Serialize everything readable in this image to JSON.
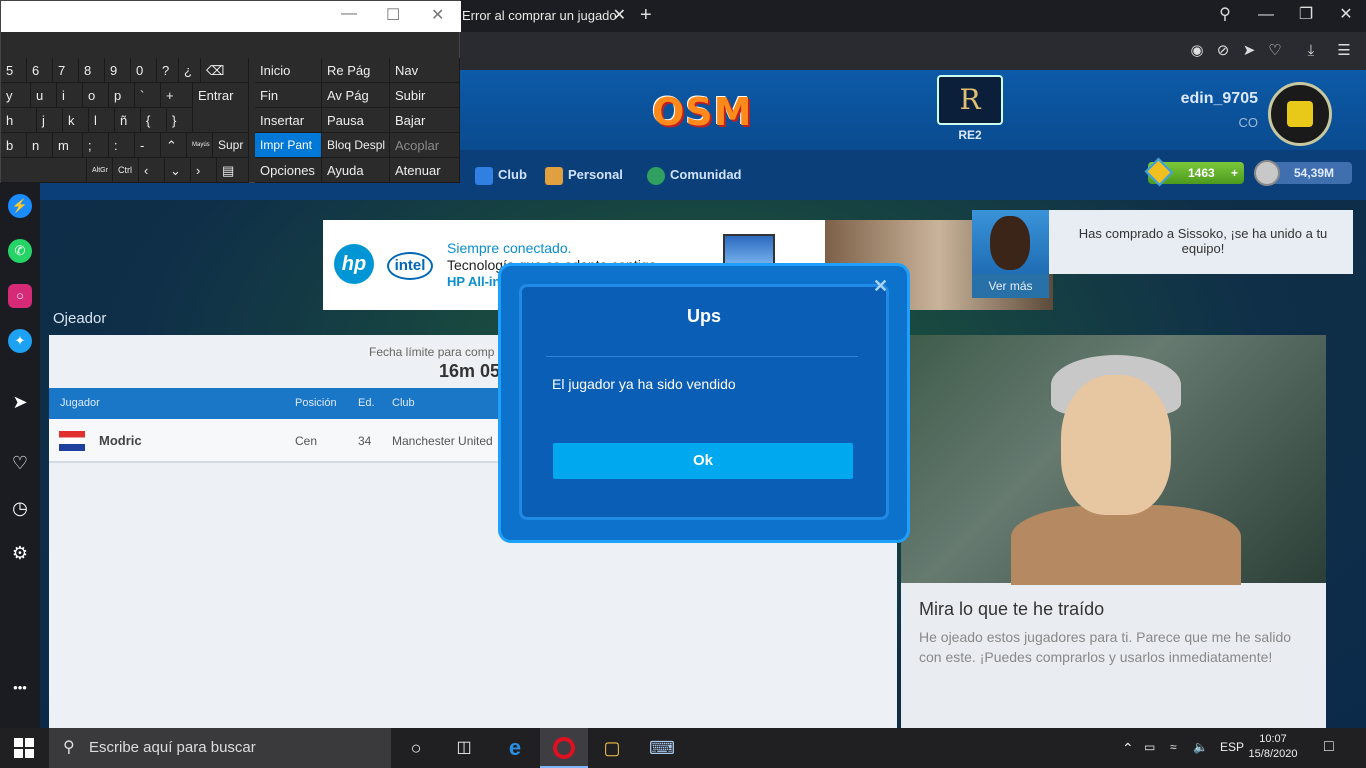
{
  "browser": {
    "tab_title": "Error al comprar un jugado",
    "tab_close": "✕",
    "new_tab": "+",
    "win_min": "—",
    "win_restore": "❐",
    "win_close": "✕",
    "search_icon": "search-icon",
    "addr_icons": [
      "camera-icon",
      "block-icon",
      "send-icon",
      "heart-icon",
      "download-icon",
      "menu-icon"
    ]
  },
  "sidebar": {
    "items": [
      "messenger-icon",
      "whatsapp-icon",
      "instagram-icon",
      "twitter-icon",
      "send-icon",
      "heart-icon",
      "clock-icon",
      "settings-icon",
      "more-icon"
    ],
    "more": "•••"
  },
  "header": {
    "logo": "OSM",
    "team_short": "RE2",
    "crest_letter": "R",
    "username": "edin_9705",
    "country": "CO"
  },
  "nav": {
    "club": "Club",
    "personal": "Personal",
    "comunidad": "Comunidad",
    "coins": "1463",
    "coins_plus": "+",
    "cash": "54,39M"
  },
  "ad": {
    "hp": "hp",
    "intel": "intel",
    "line1": "Siempre conectado.",
    "line2": "Tecnología que se adapta contigo",
    "line3": "HP All-in-"
  },
  "notification": {
    "text": "Has comprado a Sissoko, ¡se ha unido a tu equipo!",
    "button": "Ver más"
  },
  "scout": {
    "section": "Ojeador",
    "deadline_label": "Fecha límite para comp",
    "timer": "16m 05",
    "headers": {
      "player": "Jugador",
      "position": "Posición",
      "age": "Ed.",
      "club": "Club"
    },
    "rows": [
      {
        "name": "Modric",
        "position": "Cen",
        "age": "34",
        "club": "Manchester United"
      }
    ],
    "panel_title": "Mira lo que te he traído",
    "panel_text": "He ojeado estos jugadores para ti. Parece que me he salido con este. ¡Puedes comprarlos y usarlos inmediatamente!"
  },
  "modal": {
    "title": "Ups",
    "message": "El jugador ya ha sido vendido",
    "ok": "Ok",
    "close": "✕"
  },
  "keyboard": {
    "row1": [
      "5",
      "6",
      "7",
      "8",
      "9",
      "0",
      "?",
      "¿"
    ],
    "row1_sup": [
      "%",
      "&",
      "/",
      "(",
      ")",
      "=",
      "'",
      "¡"
    ],
    "row2": [
      "y",
      "u",
      "i",
      "o",
      "p",
      "`",
      "+"
    ],
    "row3": [
      "h",
      "j",
      "k",
      "l",
      "ñ",
      "{",
      "}"
    ],
    "row4": [
      "b",
      "n",
      "m",
      ";",
      ":",
      "-"
    ],
    "row4_sub": [
      ",",
      ".",
      "_"
    ],
    "enter": "Entrar",
    "supr": "Supr",
    "mayus": "Mayús",
    "altgr": "AltGr",
    "ctrl": "Ctrl",
    "nav_keys": [
      [
        "Inicio",
        "Re Pág",
        "Nav"
      ],
      [
        "Fin",
        "Av Pág",
        "Subir"
      ],
      [
        "Insertar",
        "Pausa",
        "Bajar"
      ],
      [
        "Impr Pant",
        "Bloq Despl",
        "Acoplar"
      ],
      [
        "Opciones",
        "Ayuda",
        "Atenuar"
      ]
    ],
    "win_min": "—",
    "win_max": "☐",
    "win_close": "✕"
  },
  "taskbar": {
    "search_placeholder": "Escribe aquí para buscar",
    "lang": "ESP",
    "time": "10:07",
    "date": "15/8/2020"
  }
}
